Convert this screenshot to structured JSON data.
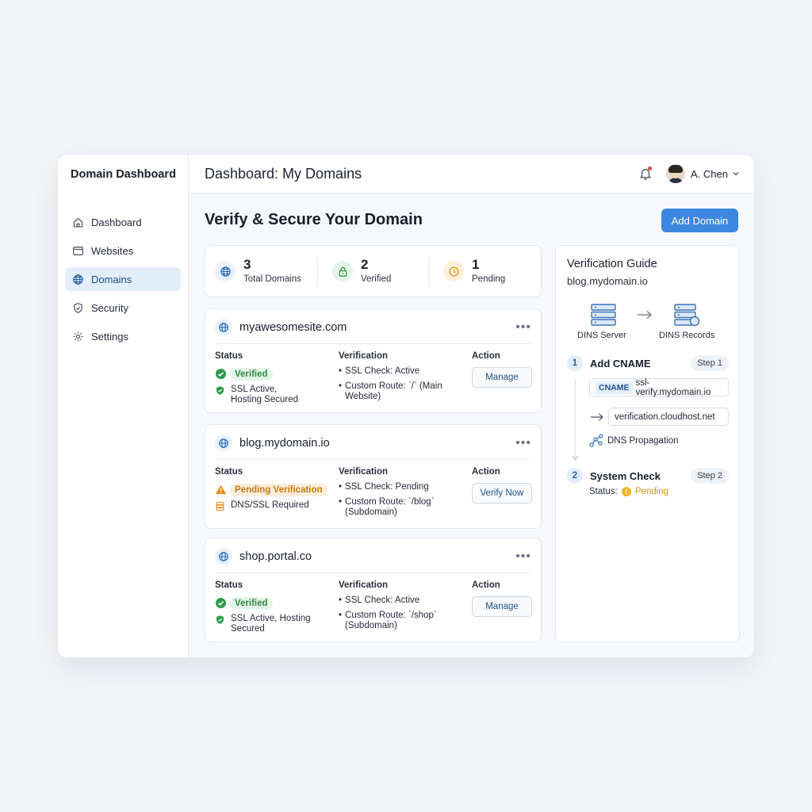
{
  "sidebar": {
    "brand": "Domain Dashboard",
    "items": [
      {
        "label": "Dashboard",
        "icon": "home-icon",
        "active": false
      },
      {
        "label": "Websites",
        "icon": "browser-window-icon",
        "active": false
      },
      {
        "label": "Domains",
        "icon": "globe-icon",
        "active": true
      },
      {
        "label": "Security",
        "icon": "shield-icon",
        "active": false
      },
      {
        "label": "Settings",
        "icon": "gear-icon",
        "active": false
      }
    ]
  },
  "header": {
    "title": "Dashboard: My Domains",
    "user_name": "A. Chen"
  },
  "main": {
    "title": "Verify & Secure Your Domain",
    "add_button": "Add Domain"
  },
  "stats": [
    {
      "value": "3",
      "label": "Total Domains",
      "icon": "globe-icon"
    },
    {
      "value": "2",
      "label": "Verified",
      "icon": "lock-icon"
    },
    {
      "value": "1",
      "label": "Pending",
      "icon": "clock-icon"
    }
  ],
  "columns": {
    "status": "Status",
    "verification": "Verification",
    "action": "Action"
  },
  "domains": [
    {
      "name": "myawesomesite.com",
      "status": "Verified",
      "status_type": "verified",
      "sub_status": "SSL Active, Hosting Secured",
      "ssl_check": "SSL Check: Active",
      "route": "Custom Route: `/` (Main Website)",
      "action": "Manage"
    },
    {
      "name": "blog.mydomain.io",
      "status": "Pending Verification",
      "status_type": "pending",
      "sub_status": "DNS/SSL Required",
      "ssl_check": "SSL Check: Pending",
      "route": "Custom Route: `/blog` (Subdomain)",
      "action": "Verify Now"
    },
    {
      "name": "shop.portal.co",
      "status": "Verified",
      "status_type": "verified",
      "sub_status": "SSL Active, Hosting Secured",
      "ssl_check": "SSL Check: Active",
      "route": "Custom Route: `/shop` (Subdomain)",
      "action": "Manage"
    }
  ],
  "guide": {
    "title": "Verification Guide",
    "domain": "blog.mydomain.io",
    "server_label": "DINS Server",
    "records_label": "DINS Records",
    "step1": {
      "num": "1",
      "title": "Add CNAME",
      "tag": "Step 1"
    },
    "cname_tag": "CNAME",
    "cname_value": "ssl-verify.mydomain.io",
    "target_value": "verification.cloudhost.net",
    "propagation": "DNS Propagation",
    "step2": {
      "num": "2",
      "title": "System Check",
      "tag": "Step 2"
    },
    "status_label": "Status:",
    "status_value": "Pending"
  },
  "colors": {
    "accent": "#3d87e0",
    "verified": "#2f8a45",
    "pending": "#c77a16"
  }
}
